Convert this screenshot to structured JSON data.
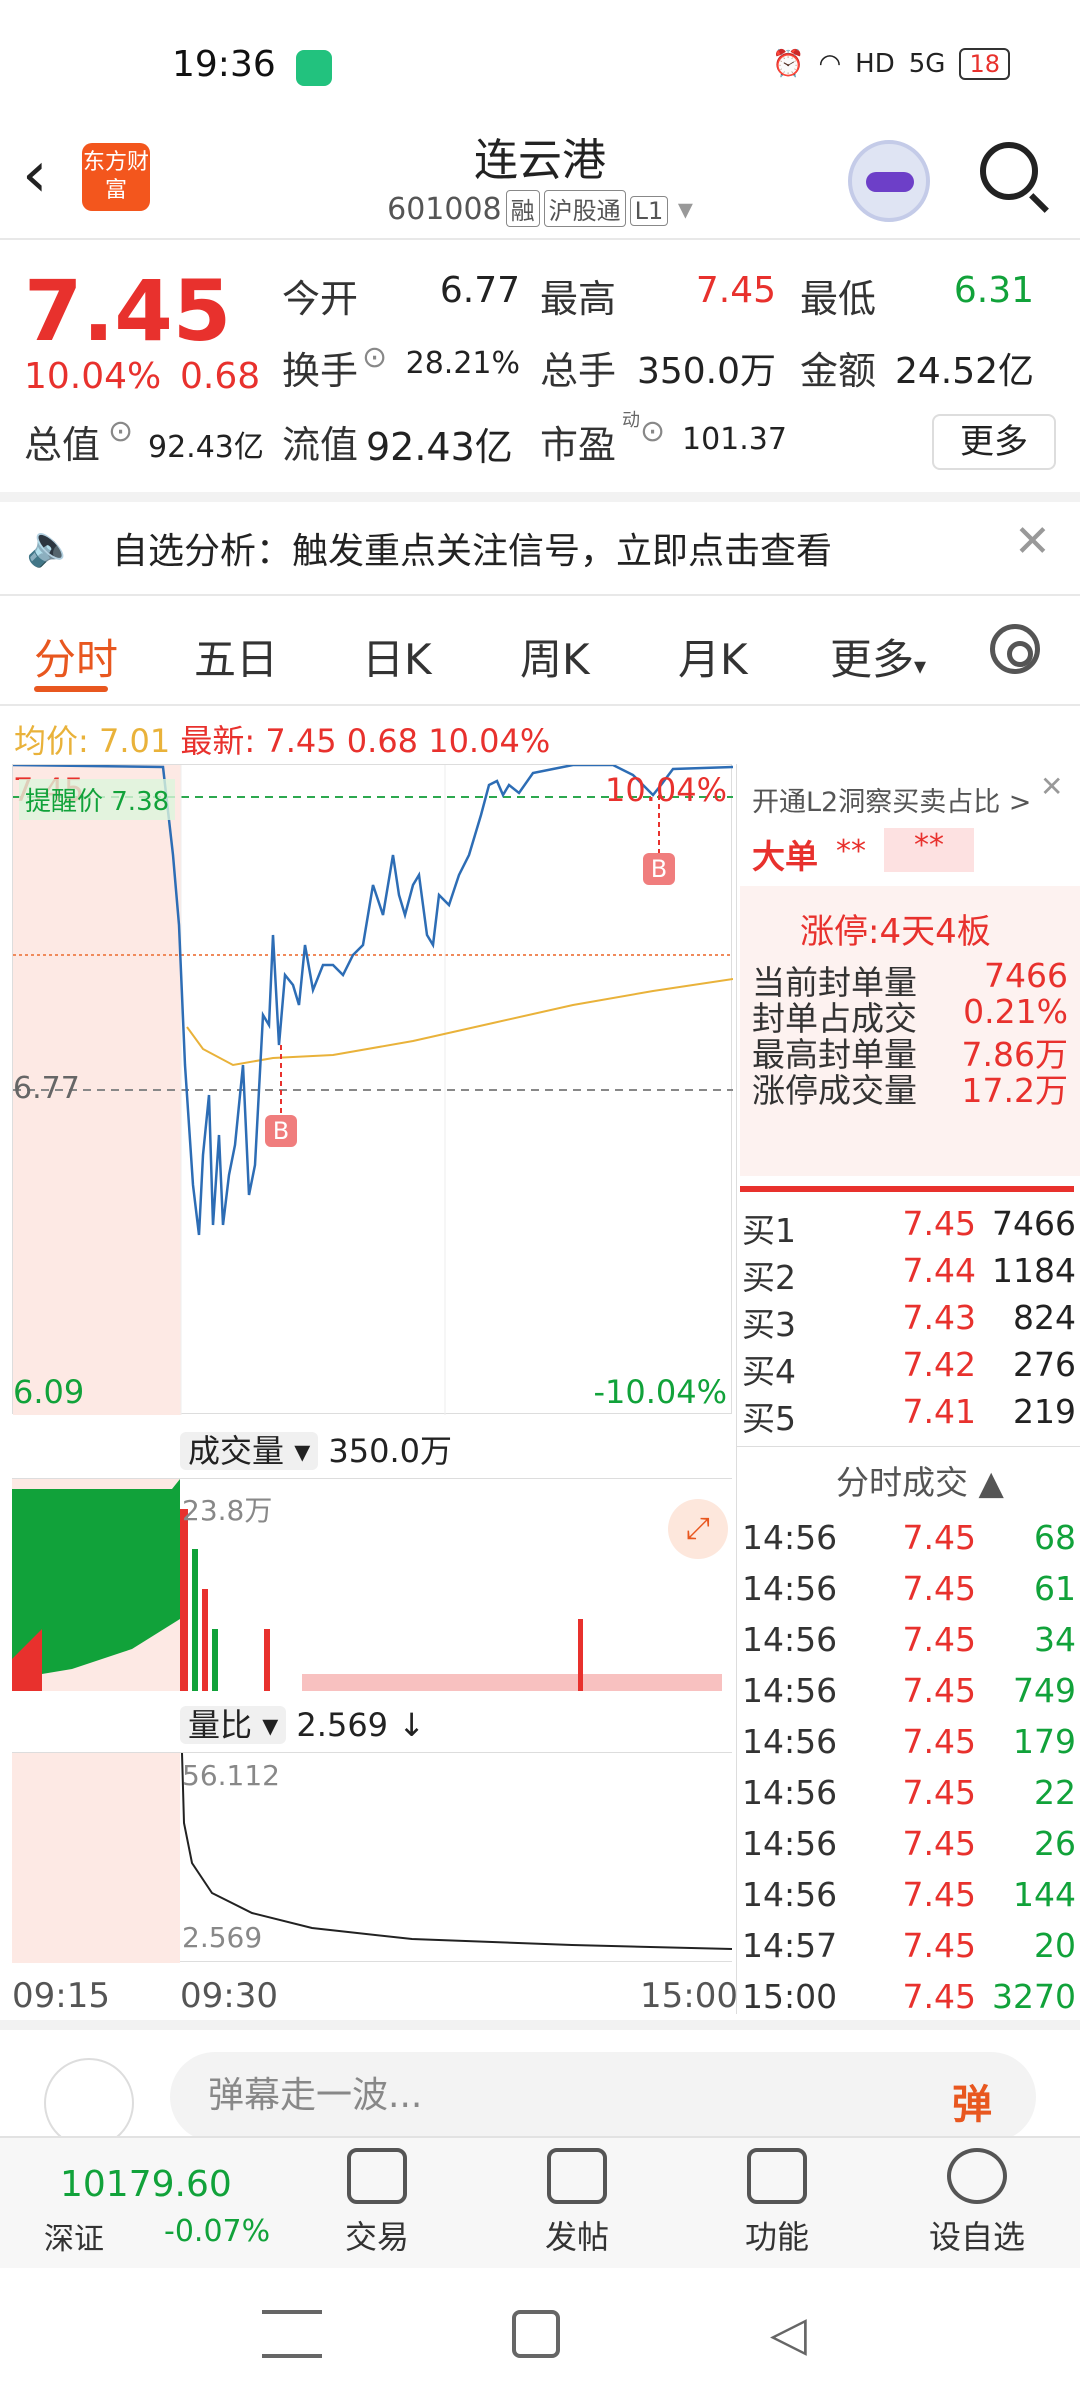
{
  "status": {
    "time": "19:36",
    "battery": "18",
    "network": "5G",
    "hd": "HD"
  },
  "header": {
    "name": "连云港",
    "code": "601008",
    "tags": [
      "融",
      "沪股通",
      "L1"
    ],
    "logo": "东方财富",
    "back_icon": "chevron-left-icon",
    "search_icon": "search-icon"
  },
  "quote": {
    "price": "7.45",
    "change_pct": "10.04%",
    "change": "0.68",
    "open_label": "今开",
    "open": "6.77",
    "high_label": "最高",
    "high": "7.45",
    "low_label": "最低",
    "low": "6.31",
    "turnover_label": "换手",
    "turnover": "28.21%",
    "volume_label": "总手",
    "volume": "350.0万",
    "amount_label": "金额",
    "amount": "24.52亿",
    "mktcap_label": "总值",
    "mktcap": "92.43亿",
    "float_label": "流值",
    "float": "92.43亿",
    "pe_label": "市盈",
    "pe_sup": "动",
    "pe": "101.37",
    "more": "更多"
  },
  "alert": {
    "text": "自选分析：触发重点关注信号，立即点击查看"
  },
  "tabs": [
    "分时",
    "五日",
    "日K",
    "周K",
    "月K",
    "更多"
  ],
  "infoline": {
    "avg_label": "均价:",
    "avg": "7.01",
    "latest_label": "最新:",
    "latest": "7.45",
    "change": "0.68",
    "pct": "10.04%"
  },
  "chart": {
    "top_price": "7.45",
    "top_pct": "10.04%",
    "remind": "提醒价 7.38",
    "mid": "6.77",
    "bottom_price": "6.09",
    "bottom_pct": "-10.04%",
    "buy_marker": "B",
    "vol_label": "成交量",
    "vol_value": "350.0万",
    "vol_max": "23.8万",
    "lb_label": "量比",
    "lb_value": "2.569",
    "lb_arrow": "↓",
    "lb_max": "56.112",
    "lb_min": "2.569",
    "times": [
      "09:15",
      "09:30",
      "15:00"
    ]
  },
  "side": {
    "l2": "开通L2洞察买卖占比 >",
    "big_label": "大单",
    "big_v1": "**",
    "big_v2": "**",
    "limit_label": "涨停:",
    "limit_val": "4天4板",
    "rows": [
      {
        "label": "当前封单量",
        "value": "7466"
      },
      {
        "label": "封单占成交",
        "value": "0.21%"
      },
      {
        "label": "最高封单量",
        "value": "7.86万"
      },
      {
        "label": "涨停成交量",
        "value": "17.2万"
      }
    ],
    "bids": [
      {
        "label": "买1",
        "price": "7.45",
        "vol": "7466"
      },
      {
        "label": "买2",
        "price": "7.44",
        "vol": "1184"
      },
      {
        "label": "买3",
        "price": "7.43",
        "vol": "824"
      },
      {
        "label": "买4",
        "price": "7.42",
        "vol": "276"
      },
      {
        "label": "买5",
        "price": "7.41",
        "vol": "219"
      }
    ],
    "ticks_title": "分时成交",
    "ticks": [
      {
        "t": "14:56",
        "p": "7.45",
        "v": "68"
      },
      {
        "t": "14:56",
        "p": "7.45",
        "v": "61"
      },
      {
        "t": "14:56",
        "p": "7.45",
        "v": "34"
      },
      {
        "t": "14:56",
        "p": "7.45",
        "v": "749"
      },
      {
        "t": "14:56",
        "p": "7.45",
        "v": "179"
      },
      {
        "t": "14:56",
        "p": "7.45",
        "v": "22"
      },
      {
        "t": "14:56",
        "p": "7.45",
        "v": "26"
      },
      {
        "t": "14:56",
        "p": "7.45",
        "v": "144"
      },
      {
        "t": "14:57",
        "p": "7.45",
        "v": "20"
      },
      {
        "t": "15:00",
        "p": "7.45",
        "v": "3270"
      }
    ]
  },
  "danmu": {
    "placeholder": "弹幕走一波...",
    "button": "弹"
  },
  "bottom": {
    "index_value": "10179.60",
    "index_name": "深证",
    "index_pct": "-0.07%",
    "items": [
      "交易",
      "发帖",
      "功能",
      "设自选"
    ]
  }
}
